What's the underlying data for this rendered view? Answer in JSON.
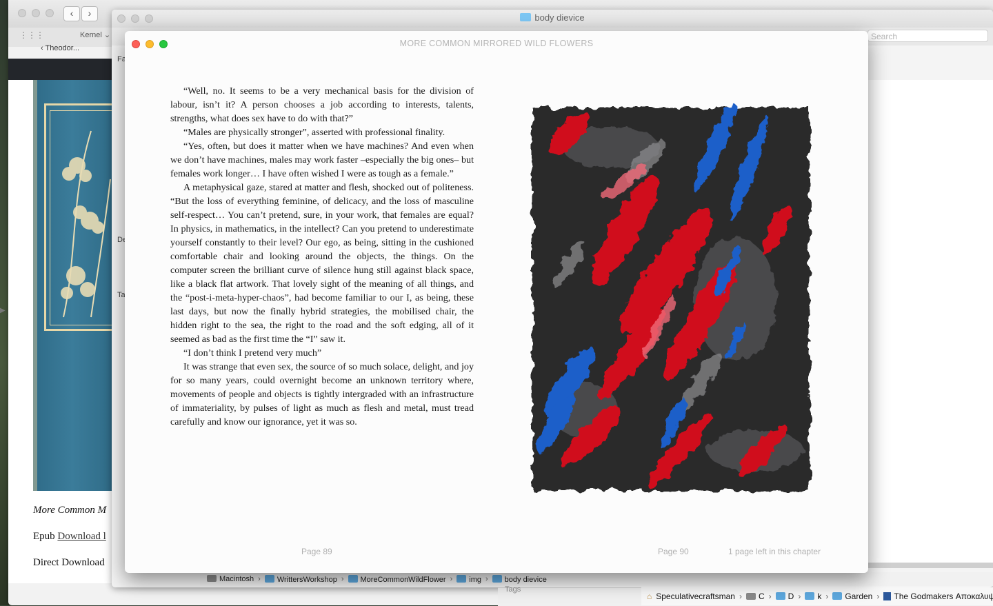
{
  "background_window": {
    "font_selector": "Kernel",
    "tab_label": "‹ Theodor...",
    "sidebar_labels": [
      "Fa",
      "De",
      "Ta"
    ],
    "caption_title": "More Common M",
    "epub_label": "Epub",
    "epub_link": "Download l",
    "direct_download": "Direct Download"
  },
  "finder_window": {
    "title": "body dievice",
    "search_placeholder": "Search",
    "tags_label": "Tags",
    "path": [
      "Macintosh",
      "WrittersWorkshop",
      "MoreCommonWildFlower",
      "img",
      "body dievice"
    ],
    "path_separator": "›"
  },
  "favorites_bar": {
    "items": [
      "Speculativecraftsman",
      "C",
      "D",
      "k",
      "Garden",
      "The Godmakers Αποκαλυψ"
    ]
  },
  "reader": {
    "title": "MORE COMMON MIRRORED WILD FLOWERS",
    "paragraphs": [
      "“Well, no. It seems to be a very mechanical basis for the division of labour, isn’t it? A person chooses a job according to interests, talents, strengths, what does sex have to do with that?”",
      "“Males are physically stronger”, asserted with professional finality.",
      "“Yes, often, but does it matter when we have machines? And even when we don’t have machines, males may work faster –especially the big ones– but females work longer… I have often wished I were as tough as a female.”",
      "A metaphysical gaze, stared at matter and flesh, shocked out of politeness. “But the loss of everything feminine, of delicacy, and the loss of masculine self-respect… You can’t pretend, sure, in your work, that females are equal? In physics, in mathematics, in the intellect? Can you pretend to underestimate yourself constantly to their level? Our ego, as being, sitting in the cushioned comfortable chair and looking around the objects, the things. On the computer screen the brilliant curve of silence hung still against black space, like a black flat artwork. That lovely sight of the meaning of all things, and the “post-i-meta-hyper-chaos”, had become familiar to our I, as being, these last days, but now the finally hybrid strategies, the mobilised chair, the hidden right to the sea, the right to the road and the soft edging, all of it seemed as bad as the first time the “I” saw it.",
      "“I don’t think I pretend very much”",
      "It was strange that even sex, the source of so much solace, delight, and joy for so many years, could overnight become an unknown terri­tory where, movements of people and objects is tightly intergraded with an infrastructure of immateriality, by pulses of light as much as flesh and metal, must tread carefully and know our ignorance, yet it was so."
    ],
    "left_page": "Page 89",
    "right_page": "Page 90",
    "pages_left": "1 page left in this chapter"
  },
  "colors": {
    "red": "#fc5f57",
    "yellow": "#fdbc2e",
    "green": "#28c840",
    "art_red": "#d0101e",
    "art_blue": "#1f5ec9"
  }
}
